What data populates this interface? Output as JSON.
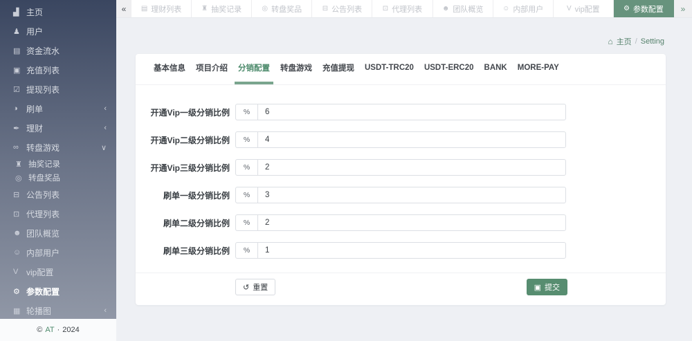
{
  "colors": {
    "accent_green": "#67937d",
    "submit_green": "#578d70",
    "breadcrumb_green": "#55816b",
    "active_tab_underline": "#7aa58e",
    "sidebar_gradient_top": "#3a4660",
    "sidebar_gradient_bottom": "#9097a6"
  },
  "sidebar": {
    "items": [
      {
        "label": "主页",
        "icon": "▟"
      },
      {
        "label": "用户",
        "icon": "♟"
      },
      {
        "label": "资金流水",
        "icon": "▤"
      },
      {
        "label": "充值列表",
        "icon": "▣"
      },
      {
        "label": "提现列表",
        "icon": "☑"
      },
      {
        "label": "刷单",
        "icon": "◑",
        "chevron": "‹"
      },
      {
        "label": "理财",
        "icon": "✒",
        "chevron": "‹"
      },
      {
        "label": "转盘游戏",
        "icon": "∞",
        "chevron": "∨"
      },
      {
        "label": "抽奖记录",
        "icon": "♜"
      },
      {
        "label": "转盘奖品",
        "icon": "◎"
      },
      {
        "label": "公告列表",
        "icon": "⊟"
      },
      {
        "label": "代理列表",
        "icon": "⊡"
      },
      {
        "label": "团队概览",
        "icon": "☻"
      },
      {
        "label": "内部用户",
        "icon": "☺"
      },
      {
        "label": "vip配置",
        "icon": "V"
      },
      {
        "label": "参数配置",
        "icon": "⚙"
      },
      {
        "label": "轮播图",
        "icon": "▦",
        "chevron": "‹"
      }
    ],
    "footer": {
      "copyright": "©",
      "brand": "AT",
      "separator": "·",
      "year": "2024"
    }
  },
  "tabbar": {
    "left_scroll": "«",
    "right_scroll": "»",
    "tabs": [
      {
        "label": "理财列表",
        "icon": "▤"
      },
      {
        "label": "抽奖记录",
        "icon": "♜"
      },
      {
        "label": "转盘奖品",
        "icon": "◎"
      },
      {
        "label": "公告列表",
        "icon": "⊟"
      },
      {
        "label": "代理列表",
        "icon": "⊡"
      },
      {
        "label": "团队概览",
        "icon": "☻"
      },
      {
        "label": "内部用户",
        "icon": "☺"
      },
      {
        "label": "vip配置",
        "icon": "V"
      },
      {
        "label": "参数配置",
        "icon": "⚙"
      }
    ]
  },
  "breadcrumb": {
    "home_icon": "⌂",
    "home": "主页",
    "separator": "/",
    "current": "Setting"
  },
  "content_tabs": [
    {
      "label": "基本信息"
    },
    {
      "label": "项目介绍"
    },
    {
      "label": "分销配置"
    },
    {
      "label": "转盘游戏"
    },
    {
      "label": "充值提现"
    },
    {
      "label": "USDT-TRC20"
    },
    {
      "label": "USDT-ERC20"
    },
    {
      "label": "BANK"
    },
    {
      "label": "MORE-PAY"
    }
  ],
  "form": {
    "rows": [
      {
        "label": "开通Vip一级分销比例",
        "prefix": "%",
        "value": "6"
      },
      {
        "label": "开通Vip二级分销比例",
        "prefix": "%",
        "value": "4"
      },
      {
        "label": "开通Vip三级分销比例",
        "prefix": "%",
        "value": "2"
      },
      {
        "label": "刷单一级分销比例",
        "prefix": "%",
        "value": "3"
      },
      {
        "label": "刷单二级分销比例",
        "prefix": "%",
        "value": "2"
      },
      {
        "label": "刷单三级分销比例",
        "prefix": "%",
        "value": "1"
      }
    ],
    "reset": {
      "icon": "↺",
      "label": "重置"
    },
    "submit": {
      "icon": "▣",
      "label": "提交"
    }
  }
}
